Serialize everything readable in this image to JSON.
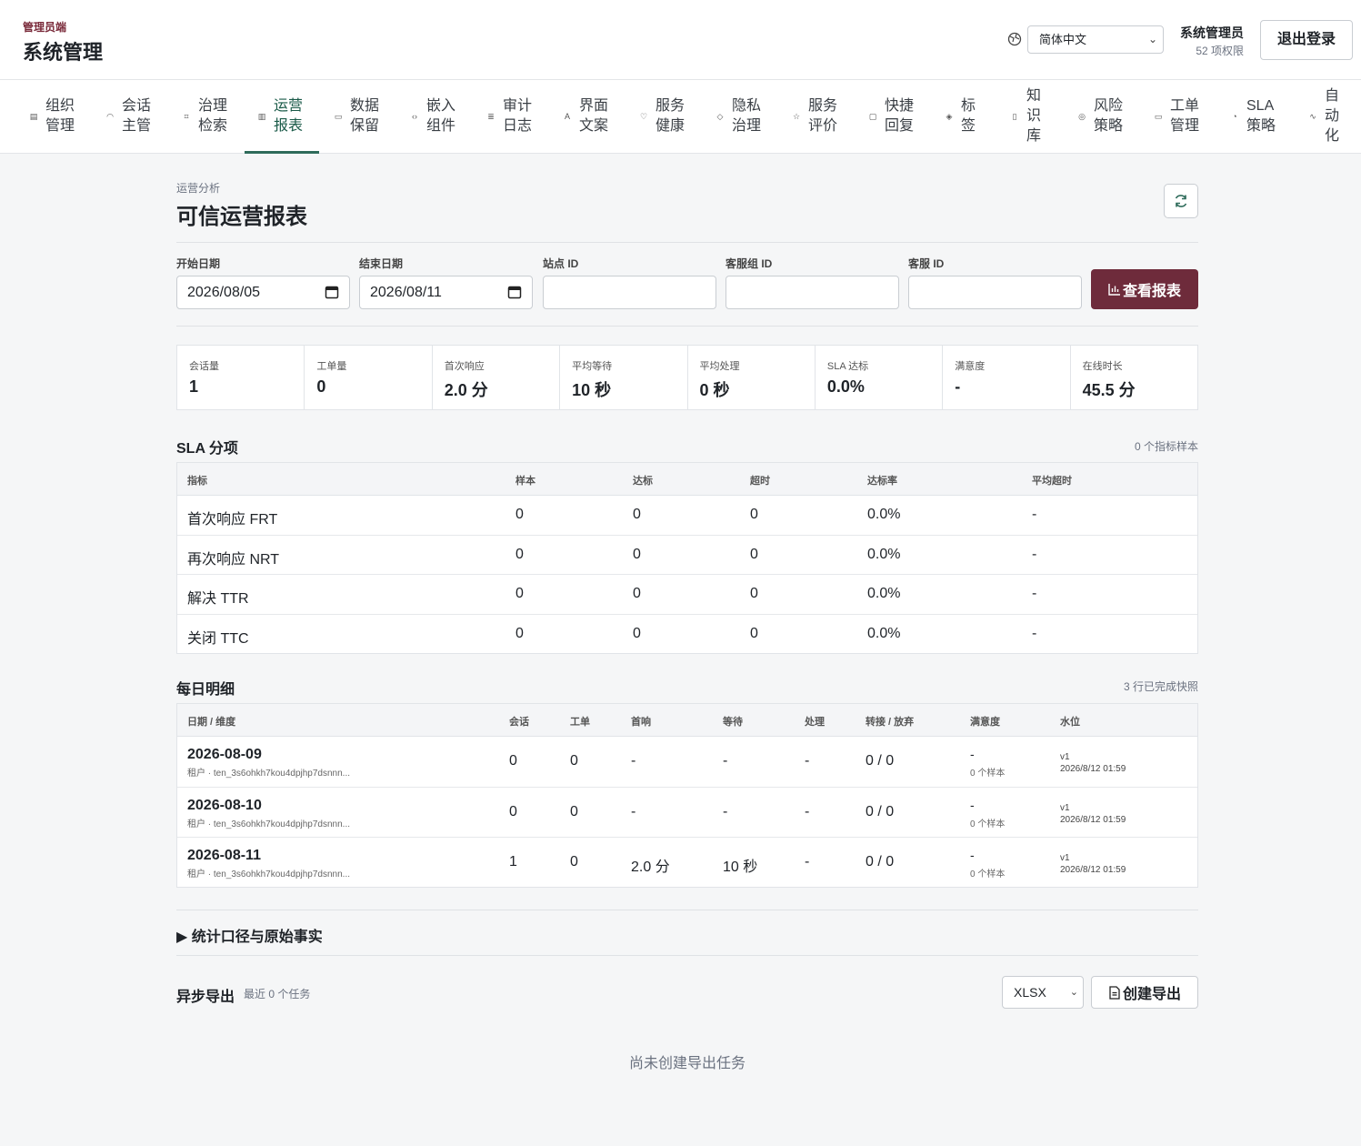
{
  "header": {
    "brand_sub": "管理员端",
    "brand_title": "系统管理",
    "language": "简体中文",
    "user_name": "系统管理员",
    "user_perm": "52 项权限",
    "logout_label": "退出登录"
  },
  "nav": [
    {
      "label": "组织管理",
      "icon": "building-icon"
    },
    {
      "label": "会话主管",
      "icon": "headset-icon"
    },
    {
      "label": "治理检索",
      "icon": "scan-icon"
    },
    {
      "label": "运营报表",
      "icon": "bar-chart-icon",
      "active": true
    },
    {
      "label": "数据保留",
      "icon": "archive-icon"
    },
    {
      "label": "嵌入组件",
      "icon": "code-icon"
    },
    {
      "label": "审计日志",
      "icon": "log-icon"
    },
    {
      "label": "界面文案",
      "icon": "translate-icon"
    },
    {
      "label": "服务健康",
      "icon": "heart-icon"
    },
    {
      "label": "隐私治理",
      "icon": "shield-icon"
    },
    {
      "label": "服务评价",
      "icon": "star-icon"
    },
    {
      "label": "快捷回复",
      "icon": "message-icon"
    },
    {
      "label": "标签",
      "icon": "tag-icon"
    },
    {
      "label": "知识库",
      "icon": "book-icon"
    },
    {
      "label": "风险策略",
      "icon": "alert-icon"
    },
    {
      "label": "工单管理",
      "icon": "ticket-icon"
    },
    {
      "label": "SLA策略",
      "icon": "timer-icon"
    },
    {
      "label": "自动化",
      "icon": "workflow-icon"
    }
  ],
  "page": {
    "crumb": "运营分析",
    "title": "可信运营报表"
  },
  "filters": {
    "start_label": "开始日期",
    "start_value": "2026/08/05",
    "end_label": "结束日期",
    "end_value": "2026/08/11",
    "site_label": "站点 ID",
    "group_label": "客服组 ID",
    "agent_label": "客服 ID",
    "view_label": "查看报表"
  },
  "kpis": [
    {
      "label": "会话量",
      "value": "1"
    },
    {
      "label": "工单量",
      "value": "0"
    },
    {
      "label": "首次响应",
      "value": "2.0 分"
    },
    {
      "label": "平均等待",
      "value": "10 秒"
    },
    {
      "label": "平均处理",
      "value": "0 秒"
    },
    {
      "label": "SLA 达标",
      "value": "0.0%"
    },
    {
      "label": "满意度",
      "value": "-"
    },
    {
      "label": "在线时长",
      "value": "45.5 分"
    }
  ],
  "sla": {
    "title": "SLA 分项",
    "note": "0 个指标样本",
    "headers": [
      "指标",
      "样本",
      "达标",
      "超时",
      "达标率",
      "平均超时"
    ],
    "rows": [
      [
        "首次响应 FRT",
        "0",
        "0",
        "0",
        "0.0%",
        "-"
      ],
      [
        "再次响应 NRT",
        "0",
        "0",
        "0",
        "0.0%",
        "-"
      ],
      [
        "解决 TTR",
        "0",
        "0",
        "0",
        "0.0%",
        "-"
      ],
      [
        "关闭 TTC",
        "0",
        "0",
        "0",
        "0.0%",
        "-"
      ]
    ]
  },
  "daily": {
    "title": "每日明细",
    "note": "3 行已完成快照",
    "headers": [
      "日期 / 维度",
      "会话",
      "工单",
      "首响",
      "等待",
      "处理",
      "转接 / 放弃",
      "满意度",
      "水位"
    ],
    "rows": [
      {
        "date": "2026-08-09",
        "tenant": "租户 · ten_3s6ohkh7kou4dpjhp7dsnnn...",
        "sessions": "0",
        "tickets": "0",
        "first": "-",
        "wait": "-",
        "handle": "-",
        "transfer": "0 / 0",
        "sat": "-",
        "sat_n": "0 个样本",
        "wm_v": "v1",
        "wm_time": "2026/8/12 01:59"
      },
      {
        "date": "2026-08-10",
        "tenant": "租户 · ten_3s6ohkh7kou4dpjhp7dsnnn...",
        "sessions": "0",
        "tickets": "0",
        "first": "-",
        "wait": "-",
        "handle": "-",
        "transfer": "0 / 0",
        "sat": "-",
        "sat_n": "0 个样本",
        "wm_v": "v1",
        "wm_time": "2026/8/12 01:59"
      },
      {
        "date": "2026-08-11",
        "tenant": "租户 · ten_3s6ohkh7kou4dpjhp7dsnnn...",
        "sessions": "1",
        "tickets": "0",
        "first": "2.0 分",
        "wait": "10 秒",
        "handle": "-",
        "transfer": "0 / 0",
        "sat": "-",
        "sat_n": "0 个样本",
        "wm_v": "v1",
        "wm_time": "2026/8/12 01:59"
      }
    ]
  },
  "details": {
    "title": "▶ 统计口径与原始事实"
  },
  "export": {
    "title": "异步导出",
    "note": "最近 0 个任务",
    "format": "XLSX",
    "create_label": "创建导出",
    "empty": "尚未创建导出任务"
  },
  "colors": {
    "accent": "#6e2b3b",
    "nav_active": "#2e6b5a"
  }
}
